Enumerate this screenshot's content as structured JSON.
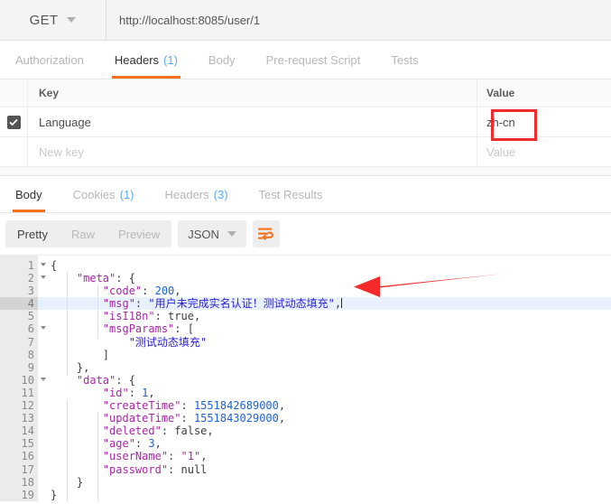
{
  "request": {
    "method": "GET",
    "url": "http://localhost:8085/user/1",
    "tabs": [
      {
        "label": "Authorization",
        "count": "",
        "active": false
      },
      {
        "label": "Headers",
        "count": "(1)",
        "active": true
      },
      {
        "label": "Body",
        "count": "",
        "active": false
      },
      {
        "label": "Pre-request Script",
        "count": "",
        "active": false
      },
      {
        "label": "Tests",
        "count": "",
        "active": false
      }
    ],
    "headers_table": {
      "columns": {
        "key": "Key",
        "value": "Value"
      },
      "rows": [
        {
          "checked": true,
          "key": "Language",
          "value": "zh-cn",
          "placeholder": false
        },
        {
          "checked": false,
          "key": "New key",
          "value": "Value",
          "placeholder": true
        }
      ]
    }
  },
  "response": {
    "tabs": [
      {
        "label": "Body",
        "count": "",
        "active": true
      },
      {
        "label": "Cookies",
        "count": "(1)",
        "active": false
      },
      {
        "label": "Headers",
        "count": "(3)",
        "active": false
      },
      {
        "label": "Test Results",
        "count": "",
        "active": false
      }
    ],
    "view_modes": [
      {
        "label": "Pretty",
        "active": true
      },
      {
        "label": "Raw",
        "active": false
      },
      {
        "label": "Preview",
        "active": false
      }
    ],
    "format": "JSON",
    "wrap_icon": "word-wrap-icon",
    "body_lines": [
      {
        "num": "1",
        "fold": true,
        "current": false,
        "tokens": [
          {
            "t": "{",
            "c": "p"
          }
        ]
      },
      {
        "num": "2",
        "fold": true,
        "current": false,
        "tokens": [
          {
            "t": "    ",
            "c": "p"
          },
          {
            "t": "\"meta\"",
            "c": "k"
          },
          {
            "t": ": {",
            "c": "p"
          }
        ]
      },
      {
        "num": "3",
        "fold": false,
        "current": false,
        "tokens": [
          {
            "t": "        ",
            "c": "p"
          },
          {
            "t": "\"code\"",
            "c": "k"
          },
          {
            "t": ": ",
            "c": "p"
          },
          {
            "t": "200",
            "c": "n"
          },
          {
            "t": ",",
            "c": "p"
          }
        ]
      },
      {
        "num": "4",
        "fold": false,
        "current": true,
        "tokens": [
          {
            "t": "        ",
            "c": "p"
          },
          {
            "t": "\"msg\"",
            "c": "k"
          },
          {
            "t": ": ",
            "c": "p"
          },
          {
            "t": "\"用户未完成实名认证！测试动态填充\"",
            "c": "s"
          },
          {
            "t": ",",
            "c": "p"
          }
        ]
      },
      {
        "num": "5",
        "fold": false,
        "current": false,
        "tokens": [
          {
            "t": "        ",
            "c": "p"
          },
          {
            "t": "\"isI18n\"",
            "c": "k"
          },
          {
            "t": ": ",
            "c": "p"
          },
          {
            "t": "true",
            "c": "b"
          },
          {
            "t": ",",
            "c": "p"
          }
        ]
      },
      {
        "num": "6",
        "fold": true,
        "current": false,
        "tokens": [
          {
            "t": "        ",
            "c": "p"
          },
          {
            "t": "\"msgParams\"",
            "c": "k"
          },
          {
            "t": ": [",
            "c": "p"
          }
        ]
      },
      {
        "num": "7",
        "fold": false,
        "current": false,
        "tokens": [
          {
            "t": "            ",
            "c": "p"
          },
          {
            "t": "\"测试动态填充\"",
            "c": "s"
          }
        ]
      },
      {
        "num": "8",
        "fold": false,
        "current": false,
        "tokens": [
          {
            "t": "        ]",
            "c": "p"
          }
        ]
      },
      {
        "num": "9",
        "fold": false,
        "current": false,
        "tokens": [
          {
            "t": "    },",
            "c": "p"
          }
        ]
      },
      {
        "num": "10",
        "fold": true,
        "current": false,
        "tokens": [
          {
            "t": "    ",
            "c": "p"
          },
          {
            "t": "\"data\"",
            "c": "k"
          },
          {
            "t": ": {",
            "c": "p"
          }
        ]
      },
      {
        "num": "11",
        "fold": false,
        "current": false,
        "tokens": [
          {
            "t": "        ",
            "c": "p"
          },
          {
            "t": "\"id\"",
            "c": "k"
          },
          {
            "t": ": ",
            "c": "p"
          },
          {
            "t": "1",
            "c": "n"
          },
          {
            "t": ",",
            "c": "p"
          }
        ]
      },
      {
        "num": "12",
        "fold": false,
        "current": false,
        "tokens": [
          {
            "t": "        ",
            "c": "p"
          },
          {
            "t": "\"createTime\"",
            "c": "k"
          },
          {
            "t": ": ",
            "c": "p"
          },
          {
            "t": "1551842689000",
            "c": "n"
          },
          {
            "t": ",",
            "c": "p"
          }
        ]
      },
      {
        "num": "13",
        "fold": false,
        "current": false,
        "tokens": [
          {
            "t": "        ",
            "c": "p"
          },
          {
            "t": "\"updateTime\"",
            "c": "k"
          },
          {
            "t": ": ",
            "c": "p"
          },
          {
            "t": "1551843029000",
            "c": "n"
          },
          {
            "t": ",",
            "c": "p"
          }
        ]
      },
      {
        "num": "14",
        "fold": false,
        "current": false,
        "tokens": [
          {
            "t": "        ",
            "c": "p"
          },
          {
            "t": "\"deleted\"",
            "c": "k"
          },
          {
            "t": ": ",
            "c": "p"
          },
          {
            "t": "false",
            "c": "b"
          },
          {
            "t": ",",
            "c": "p"
          }
        ]
      },
      {
        "num": "15",
        "fold": false,
        "current": false,
        "tokens": [
          {
            "t": "        ",
            "c": "p"
          },
          {
            "t": "\"age\"",
            "c": "k"
          },
          {
            "t": ": ",
            "c": "p"
          },
          {
            "t": "3",
            "c": "n"
          },
          {
            "t": ",",
            "c": "p"
          }
        ]
      },
      {
        "num": "16",
        "fold": false,
        "current": false,
        "tokens": [
          {
            "t": "        ",
            "c": "p"
          },
          {
            "t": "\"userName\"",
            "c": "k"
          },
          {
            "t": ": ",
            "c": "p"
          },
          {
            "t": "\"1\"",
            "c": "k"
          },
          {
            "t": ",",
            "c": "p"
          }
        ]
      },
      {
        "num": "17",
        "fold": false,
        "current": false,
        "tokens": [
          {
            "t": "        ",
            "c": "p"
          },
          {
            "t": "\"password\"",
            "c": "k"
          },
          {
            "t": ": ",
            "c": "p"
          },
          {
            "t": "null",
            "c": "b"
          }
        ]
      },
      {
        "num": "18",
        "fold": false,
        "current": false,
        "tokens": [
          {
            "t": "    }",
            "c": "p"
          }
        ]
      },
      {
        "num": "19",
        "fold": false,
        "current": false,
        "tokens": [
          {
            "t": "}",
            "c": "p"
          }
        ]
      }
    ]
  },
  "annotations": {
    "highlight_color": "#ef2c2c",
    "arrow_color": "#f62a2a",
    "value_box_target": "zh-cn",
    "arrow_target_line": "4"
  },
  "colors": {
    "accent": "#f37021",
    "link": "#5aaaf2",
    "annotation_red": "#ef2c2c"
  }
}
